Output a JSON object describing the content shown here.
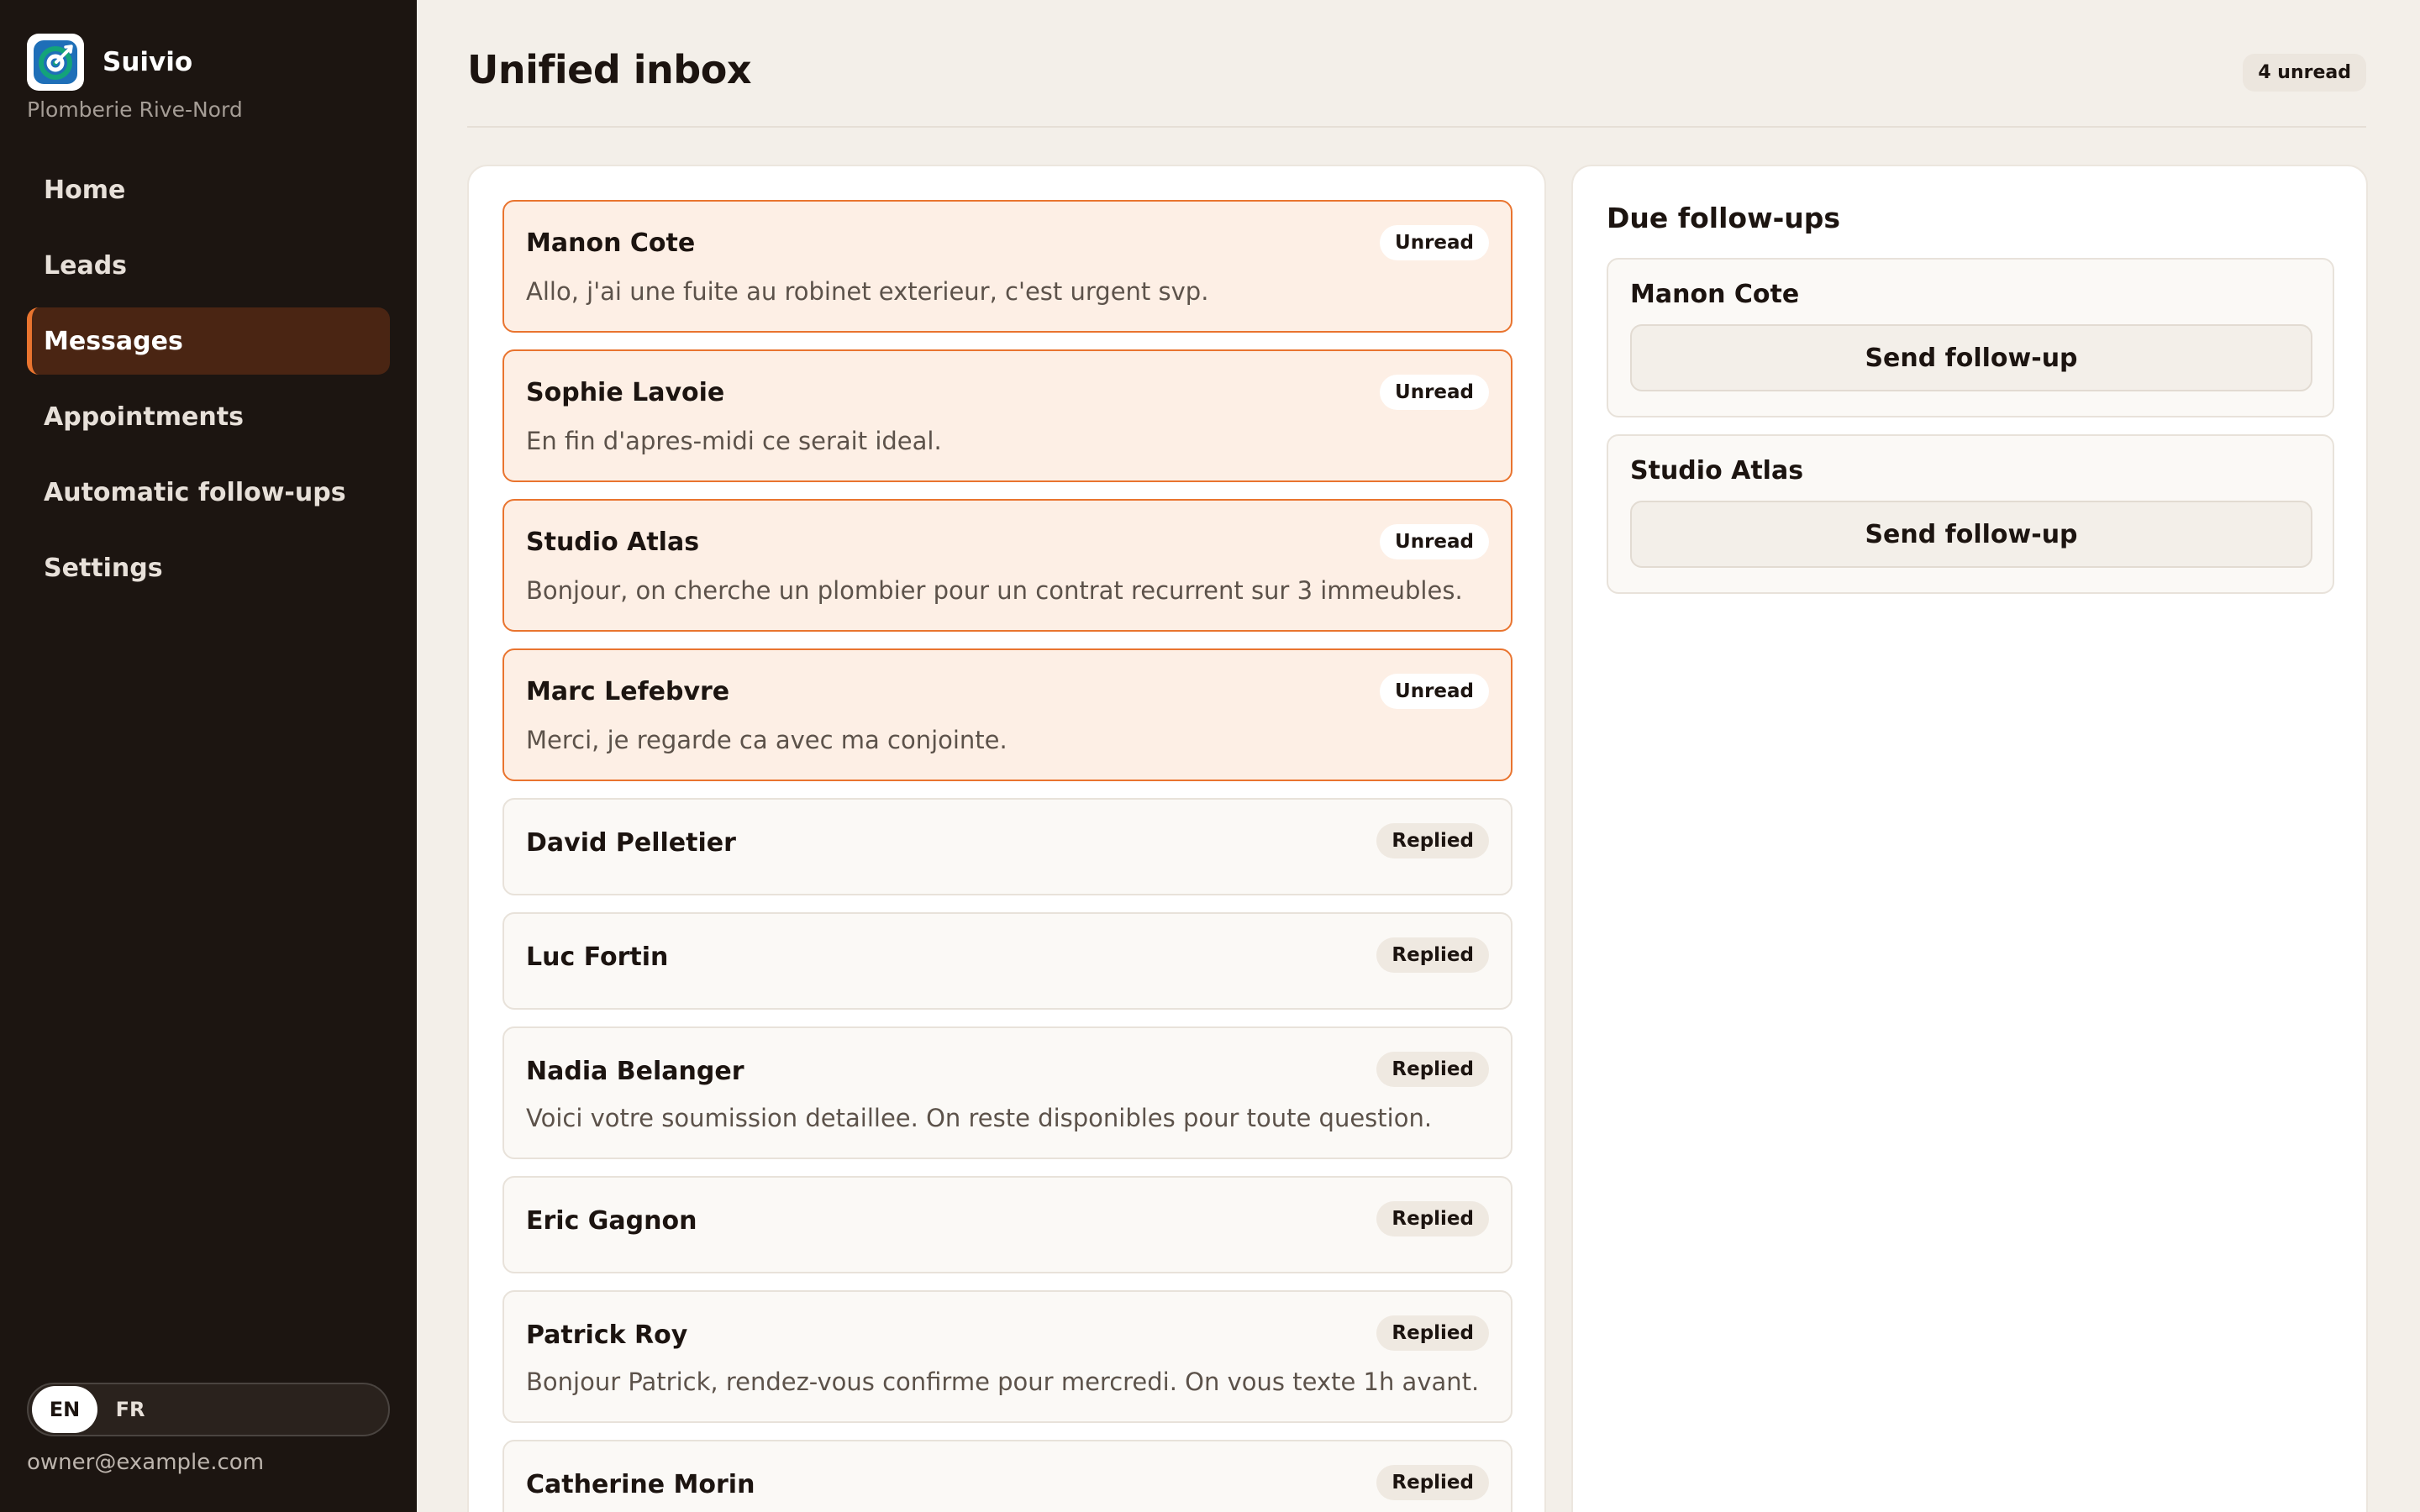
{
  "app": {
    "name": "Suivio",
    "organization": "Plomberie Rive-Nord",
    "user_email": "owner@example.com"
  },
  "colors": {
    "accent": "#e9742f",
    "sidebar_bg": "#1c1511",
    "active_nav_bg": "#4a2513",
    "unread_card_bg": "#fdefe5",
    "logo_green": "#13a37a",
    "logo_blue": "#1e6fb8"
  },
  "sidebar": {
    "logo_icon": "target-icon",
    "items": [
      {
        "label": "Home",
        "active": false
      },
      {
        "label": "Leads",
        "active": false
      },
      {
        "label": "Messages",
        "active": true
      },
      {
        "label": "Appointments",
        "active": false
      },
      {
        "label": "Automatic follow-ups",
        "active": false
      },
      {
        "label": "Settings",
        "active": false
      }
    ],
    "languages": [
      {
        "label": "EN",
        "active": true
      },
      {
        "label": "FR",
        "active": false
      }
    ]
  },
  "header": {
    "title": "Unified inbox",
    "unread_count": "4 unread"
  },
  "messages": [
    {
      "name": "Manon Cote",
      "status": "Unread",
      "preview": "Allo, j'ai une fuite au robinet exterieur, c'est urgent svp."
    },
    {
      "name": "Sophie Lavoie",
      "status": "Unread",
      "preview": "En fin d'apres-midi ce serait ideal."
    },
    {
      "name": "Studio Atlas",
      "status": "Unread",
      "preview": "Bonjour, on cherche un plombier pour un contrat recurrent sur 3 immeubles."
    },
    {
      "name": "Marc Lefebvre",
      "status": "Unread",
      "preview": "Merci, je regarde ca avec ma conjointe."
    },
    {
      "name": "David Pelletier",
      "status": "Replied",
      "preview": ""
    },
    {
      "name": "Luc Fortin",
      "status": "Replied",
      "preview": ""
    },
    {
      "name": "Nadia Belanger",
      "status": "Replied",
      "preview": "Voici votre soumission detaillee. On reste disponibles pour toute question."
    },
    {
      "name": "Eric Gagnon",
      "status": "Replied",
      "preview": ""
    },
    {
      "name": "Patrick Roy",
      "status": "Replied",
      "preview": "Bonjour Patrick, rendez-vous confirme pour mercredi. On vous texte 1h avant."
    },
    {
      "name": "Catherine Morin",
      "status": "Replied",
      "preview": ""
    }
  ],
  "followups": {
    "title": "Due follow-ups",
    "items": [
      {
        "name": "Manon Cote",
        "action": "Send follow-up"
      },
      {
        "name": "Studio Atlas",
        "action": "Send follow-up"
      }
    ]
  }
}
